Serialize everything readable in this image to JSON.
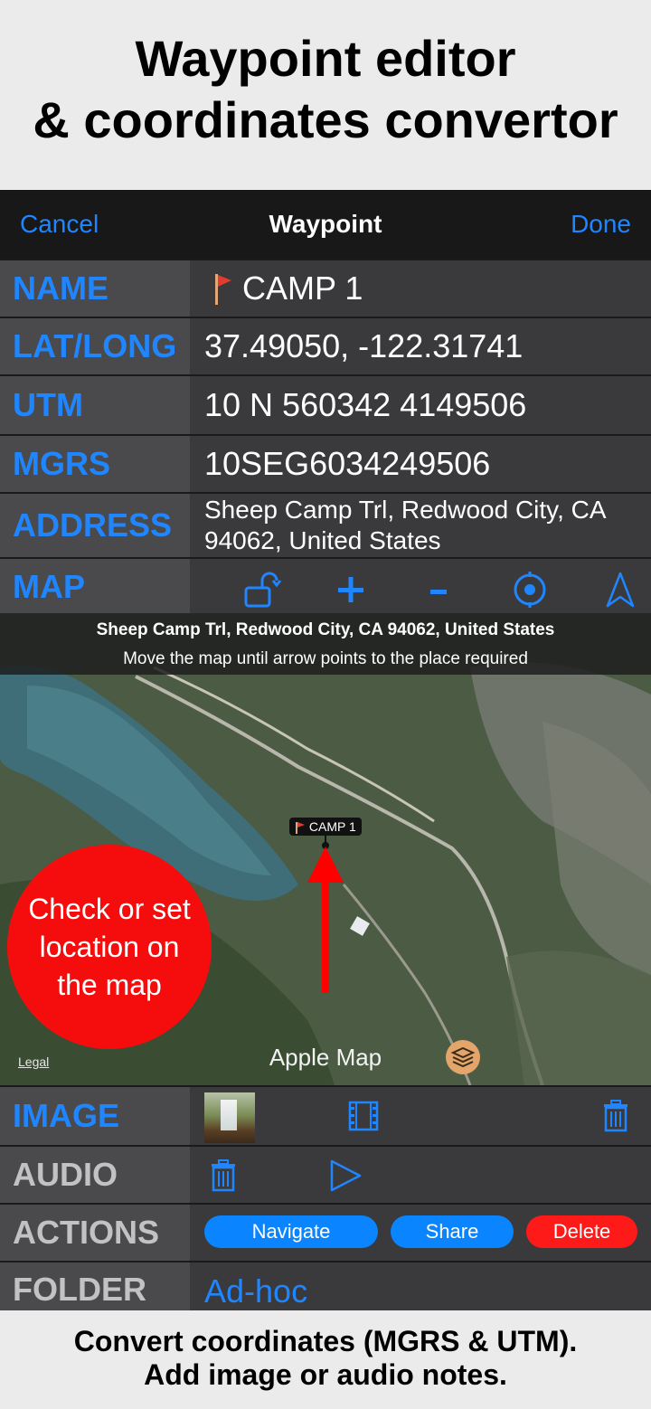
{
  "promo_top": {
    "line1": "Waypoint editor",
    "line2": "& coordinates convertor"
  },
  "navbar": {
    "cancel": "Cancel",
    "title": "Waypoint",
    "done": "Done"
  },
  "rows": {
    "name": {
      "label": "NAME",
      "value": "CAMP 1"
    },
    "latlong": {
      "label": "LAT/LONG",
      "value": "37.49050, -122.31741"
    },
    "utm": {
      "label": "UTM",
      "value": "10 N 560342 4149506"
    },
    "mgrs": {
      "label": "MGRS",
      "value": "10SEG6034249506"
    },
    "address": {
      "label": "ADDRESS",
      "value": "Sheep Camp Trl, Redwood City, CA 94062, United States"
    },
    "map": {
      "label": "MAP"
    },
    "image": {
      "label": "IMAGE"
    },
    "audio": {
      "label": "AUDIO"
    },
    "actions": {
      "label": "ACTIONS",
      "navigate": "Navigate",
      "share": "Share",
      "delete": "Delete"
    },
    "folder": {
      "label": "FOLDER",
      "value": "Ad-hoc"
    }
  },
  "map": {
    "address": "Sheep Camp Trl, Redwood City, CA  94062, United States",
    "hint": "Move the map until arrow points to the place required",
    "pin_label": "CAMP 1",
    "provider": "Apple Map",
    "legal": "Legal",
    "callout": "Check or set location on the map"
  },
  "promo_bottom": {
    "line1": "Convert coordinates (MGRS & UTM).",
    "line2": "Add image or audio notes."
  },
  "colors": {
    "accent": "#1f86ff",
    "delete": "#ff1a1a",
    "callout": "#f50d0d",
    "label_gray": "#c2c2c4"
  },
  "icons": [
    "flag-icon",
    "rotate-lock-icon",
    "plus-icon",
    "minus-icon",
    "locate-icon",
    "navigation-arrow-icon",
    "film-icon",
    "trash-icon",
    "play-icon",
    "layers-icon"
  ]
}
